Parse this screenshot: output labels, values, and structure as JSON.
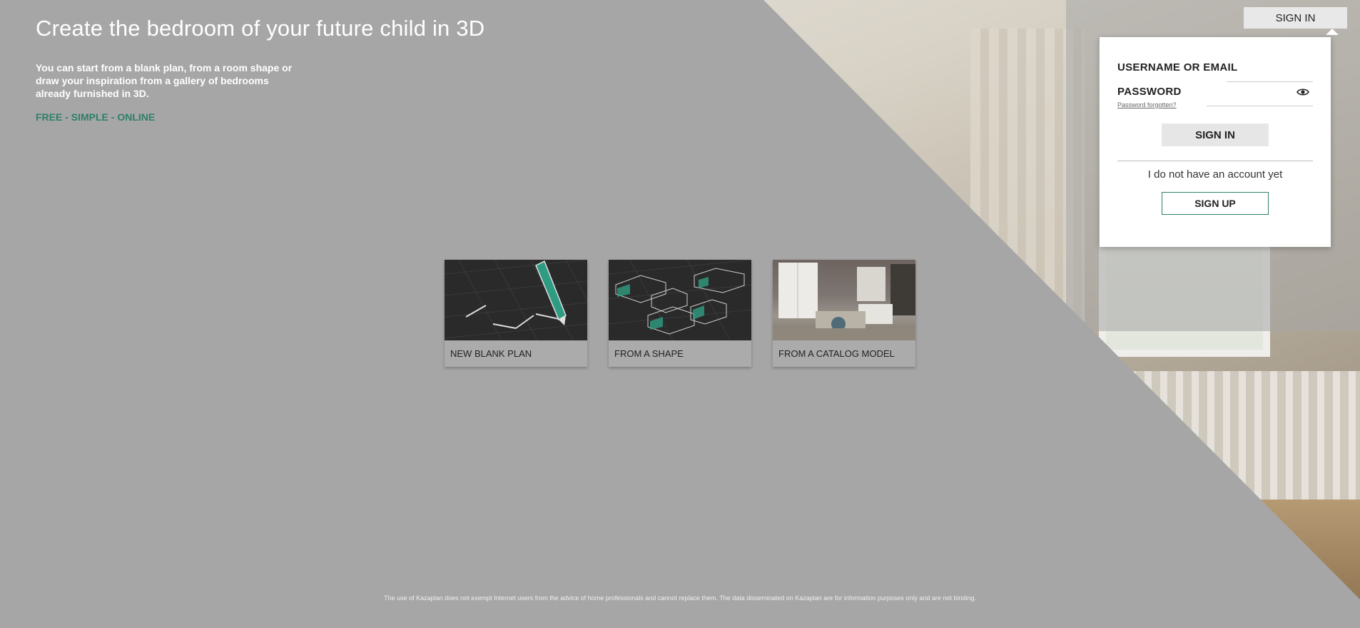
{
  "header": {
    "title": "Create the bedroom of your future child in 3D",
    "intro": "You can start from a blank plan, from a room shape or draw your inspiration from a gallery of bedrooms already furnished in 3D.",
    "tagline": "FREE - SIMPLE - ONLINE"
  },
  "cards": [
    {
      "label": "NEW BLANK PLAN",
      "icon": "pencil-drawing-icon"
    },
    {
      "label": "FROM A SHAPE",
      "icon": "room-shapes-icon"
    },
    {
      "label": "FROM A CATALOG MODEL",
      "icon": "furnished-room-photo"
    }
  ],
  "top_bar": {
    "signin_label": "SIGN IN"
  },
  "login": {
    "username_label": "USERNAME OR EMAIL",
    "username_value": "",
    "password_label": "PASSWORD",
    "password_value": "",
    "forgot_label": "Password forgotten?",
    "signin_button": "SIGN IN",
    "no_account_text": "I do not have an account yet",
    "signup_button": "SIGN UP",
    "eye_icon": "eye-icon"
  },
  "footer": {
    "disclaimer": "The use of Kazaplan does not exempt Internet users from the advice of home professionals and cannot replace them. The data disseminated on Kazaplan are for information purposes only and are not binding."
  },
  "colors": {
    "accent": "#2f7f6a",
    "overlay": "#a6a6a6"
  }
}
